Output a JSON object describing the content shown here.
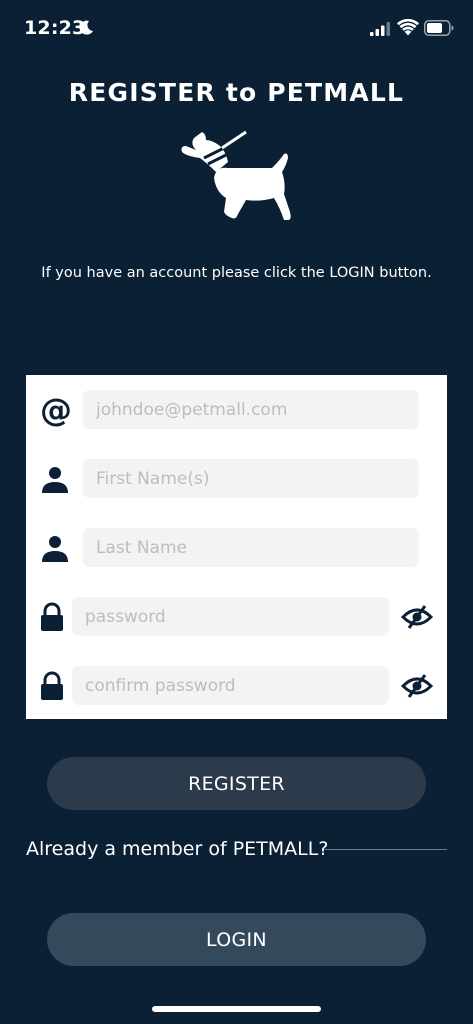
{
  "status_bar": {
    "time": "12:23",
    "icons": [
      "moon-icon",
      "cellular-signal-icon",
      "wifi-icon",
      "battery-icon"
    ]
  },
  "header": {
    "title": "REGISTER to PETMALL",
    "logo": "dog-icon"
  },
  "info": "If you have an account please click the LOGIN button.",
  "form": {
    "email": {
      "icon": "at-icon",
      "glyph": "@",
      "placeholder": "johndoe@petmall.com",
      "value": ""
    },
    "first_name": {
      "icon": "person-icon",
      "placeholder": "First Name(s)",
      "value": ""
    },
    "last_name": {
      "icon": "person-icon",
      "placeholder": "Last Name",
      "value": ""
    },
    "password": {
      "icon": "lock-icon",
      "placeholder": "password",
      "value": "",
      "toggle_icon": "eye-slash-icon"
    },
    "confirm_password": {
      "icon": "lock-icon",
      "placeholder": "confirm password",
      "value": "",
      "toggle_icon": "eye-slash-icon"
    }
  },
  "actions": {
    "register_label": "REGISTER",
    "member_prompt": "Already a member of PETMALL?",
    "login_label": "LOGIN"
  },
  "colors": {
    "background": "#0b1f35",
    "card": "#ffffff",
    "input_bg": "#f3f3f3",
    "icon": "#0b1f35",
    "register_button": "#2c3b4c",
    "login_button": "#35495d"
  }
}
